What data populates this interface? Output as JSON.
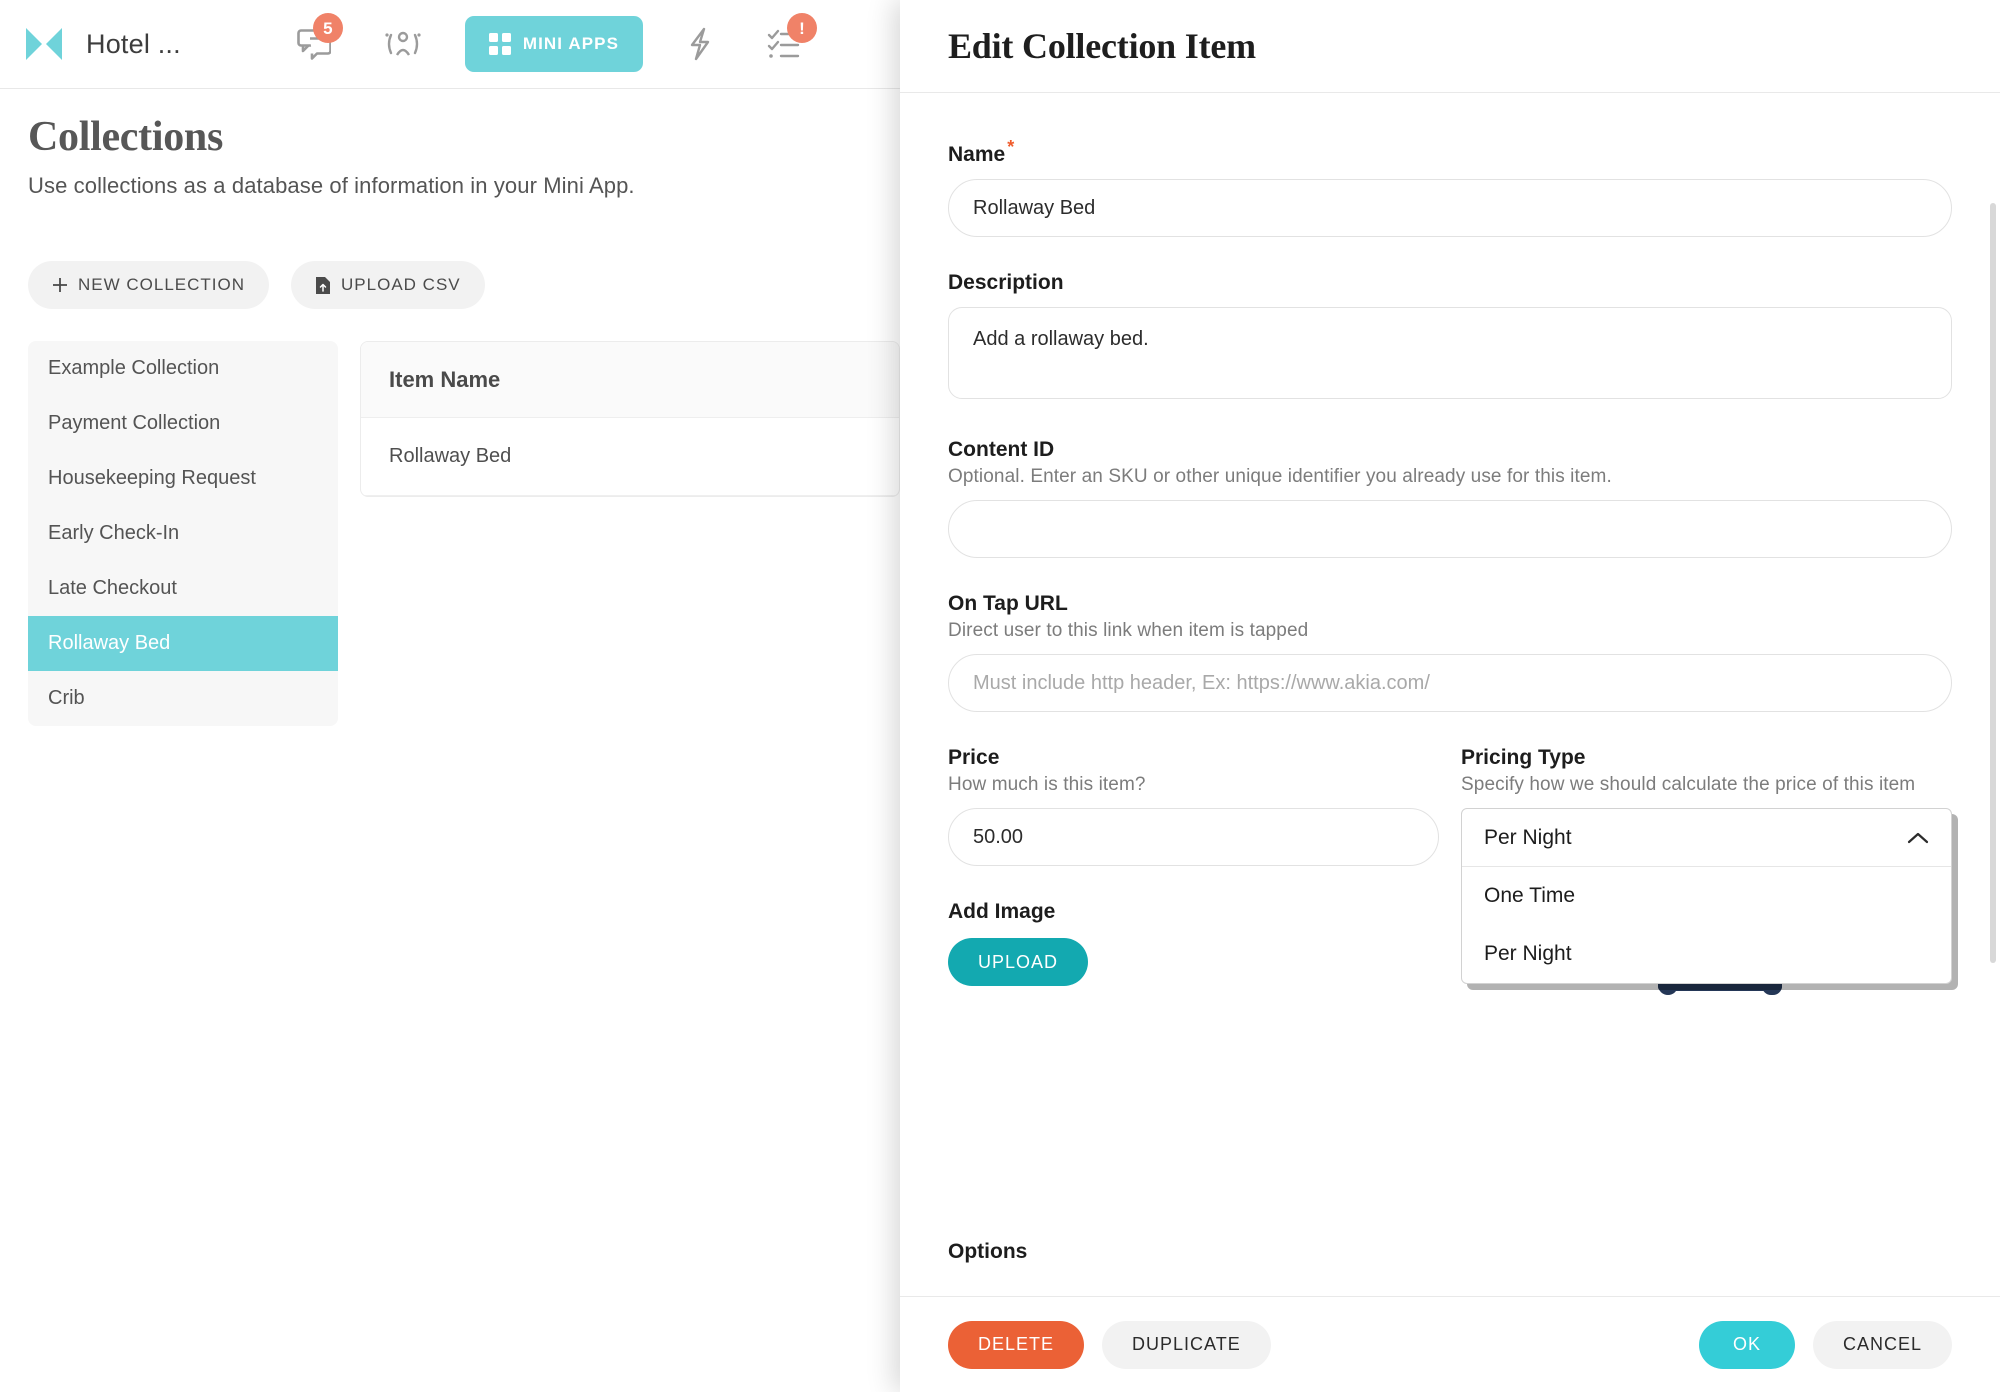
{
  "topnav": {
    "brand_title": "Hotel ...",
    "logo_icon": "akia-logo-icon",
    "items": [
      {
        "icon": "chat-bubbles-icon",
        "badge": "5",
        "name": "messages"
      },
      {
        "icon": "guests-icon",
        "badge": "",
        "name": "guests"
      },
      {
        "icon": "mini-apps-grid-icon",
        "label": "MINI APPS",
        "name": "mini-apps"
      },
      {
        "icon": "lightning-bolt-icon",
        "badge": "",
        "name": "automations"
      },
      {
        "icon": "tasks-checklist-icon",
        "badge": "!",
        "name": "tasks"
      }
    ]
  },
  "page": {
    "title": "Collections",
    "subtitle": "Use collections as a database of information in your Mini App.",
    "new_collection_label": "NEW COLLECTION",
    "upload_csv_label": "UPLOAD CSV",
    "collections": [
      "Example Collection",
      "Payment Collection",
      "Housekeeping Request",
      "Early Check-In",
      "Late Checkout",
      "Rollaway Bed",
      "Crib"
    ],
    "selected_collection": "Rollaway Bed",
    "table": {
      "column_header": "Item Name",
      "rows": [
        "Rollaway Bed"
      ]
    }
  },
  "modal": {
    "title": "Edit Collection Item",
    "name": {
      "label": "Name",
      "required_mark": "*",
      "value": "Rollaway Bed"
    },
    "description": {
      "label": "Description",
      "value": "Add a rollaway bed."
    },
    "content_id": {
      "label": "Content ID",
      "help": "Optional. Enter an SKU or other unique identifier you already use for this item.",
      "value": "",
      "placeholder": ""
    },
    "on_tap_url": {
      "label": "On Tap URL",
      "help": "Direct user to this link when item is tapped",
      "value": "",
      "placeholder": "Must include http header, Ex: https://www.akia.com/"
    },
    "price": {
      "label": "Price",
      "help": "How much is this item?",
      "value": "50.00"
    },
    "pricing_type": {
      "label": "Pricing Type",
      "help": "Specify how we should calculate the price of this item",
      "selected": "Per Night",
      "open": true,
      "options": [
        "One Time",
        "Per Night"
      ]
    },
    "add_image": {
      "label": "Add Image",
      "upload_label": "UPLOAD",
      "preview_icon": "bed-icon"
    },
    "options_label": "Options",
    "footer": {
      "delete_label": "DELETE",
      "duplicate_label": "DUPLICATE",
      "ok_label": "OK",
      "cancel_label": "CANCEL"
    }
  },
  "colors": {
    "teal": "#6fd3da",
    "teal_dark": "#13a9b0",
    "ok_teal": "#34cdd7",
    "orange": "#eb6136",
    "badge_orange": "#f08268",
    "navy": "#243757"
  }
}
